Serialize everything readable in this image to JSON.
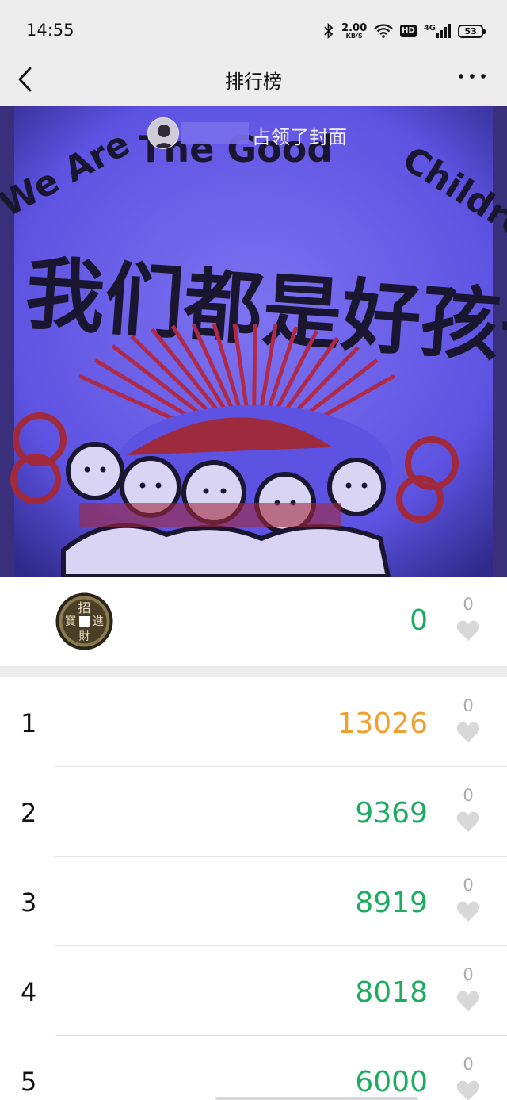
{
  "status_bar": {
    "time": "14:55",
    "network_speed_value": "2.00",
    "network_speed_unit": "KB/S",
    "hd_label": "HD",
    "network_type": "4G",
    "battery": "53",
    "icons": [
      "bluetooth-icon",
      "wifi-icon",
      "hd-icon",
      "cellular-signal-icon",
      "battery-icon"
    ]
  },
  "nav": {
    "title": "排行榜",
    "back_icon": "chevron-left-icon",
    "more_icon": "more-dots-icon"
  },
  "cover": {
    "caption": "占领了封面",
    "mug_text_english": "We Are The Good Children",
    "mug_text_chinese": "我们都是好孩子"
  },
  "my_rank": {
    "steps": "0",
    "likes": "0",
    "steps_color": "#1aad5f"
  },
  "ranking": [
    {
      "rank": "1",
      "steps": "13026",
      "likes": "0",
      "color": "#f0a030"
    },
    {
      "rank": "2",
      "steps": "9369",
      "likes": "0",
      "color": "#1aad5f"
    },
    {
      "rank": "3",
      "steps": "8919",
      "likes": "0",
      "color": "#1aad5f"
    },
    {
      "rank": "4",
      "steps": "8018",
      "likes": "0",
      "color": "#1aad5f"
    },
    {
      "rank": "5",
      "steps": "6000",
      "likes": "0",
      "color": "#1aad5f"
    }
  ],
  "colors": {
    "background": "#ededed",
    "first_place": "#f0a030",
    "steps_green": "#1aad5f",
    "like_gray": "#cccccc"
  }
}
